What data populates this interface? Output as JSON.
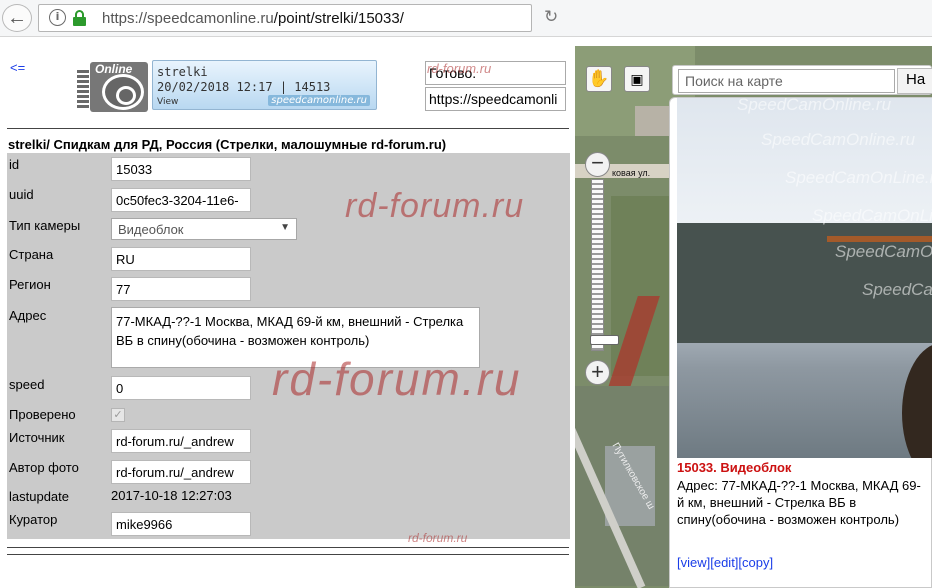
{
  "browser": {
    "url_host": "https://speedcamonline.ru",
    "url_path": "/point/strelki/15033/"
  },
  "page": {
    "back_link": "<=",
    "banner": {
      "logo_text": "Online",
      "line1": "strelki",
      "line2": "20/02/2018 12:17 | 14513",
      "line3": "View",
      "brand": "speedcamonline.ru"
    },
    "status_box": "Готово.",
    "url_box": "https://speedcamonli",
    "heading": "strelki/ Спидкам для РД, Россия (Стрелки, малошумные rd-forum.ru)",
    "watermark": "rd-forum.ru",
    "watermark_big": "rd-forum.ru"
  },
  "form": {
    "id_label": "id",
    "id_value": "15033",
    "uuid_label": "uuid",
    "uuid_value": "0c50fec3-3204-11e6-",
    "type_label": "Тип камеры",
    "type_value": "Видеоблок",
    "country_label": "Страна",
    "country_value": "RU",
    "region_label": "Регион",
    "region_value": "77",
    "address_label": "Адрес",
    "address_value": "77-МКАД-??-1 Москва, МКАД 69-й км, внешний - Стрелка ВБ в спину(обочина - возможен контроль)",
    "speed_label": "speed",
    "speed_value": "0",
    "verified_label": "Проверено",
    "verified": true,
    "source_label": "Источник",
    "source_value": "rd-forum.ru/_andrew",
    "photo_author_label": "Автор фото",
    "photo_author_value": "rd-forum.ru/_andrew",
    "lastupdate_label": "lastupdate",
    "lastupdate_value": "2017-10-18 12:27:03",
    "curator_label": "Куратор",
    "curator_value": "mike9966"
  },
  "map": {
    "search_placeholder": "Поиск на карте",
    "search_button": "На",
    "street1": "ковая ул.",
    "street2": "Путилковское ш",
    "popup": {
      "title": "15033. Видеоблок",
      "address": "Адрес: 77-МКАД-??-1 Москва, МКАД 69-й км, внешний - Стрелка ВБ в спину(обочина - возможен контроль)",
      "link_view": "[view]",
      "link_edit": "[edit]",
      "link_copy": "[copy]",
      "photo_watermarks": [
        "SpeedCamOnline.ru",
        "SpeedCamOnline.ru",
        "SpeedCamOnLine.ru",
        "SpeedCamOnLine.ru",
        "SpeedCamOn",
        "SpeedCa"
      ]
    }
  },
  "colors": {
    "link": "#1a3de8",
    "form_bg": "#cacaca",
    "popup_title": "#cc1111",
    "watermark": "#aa2828"
  }
}
